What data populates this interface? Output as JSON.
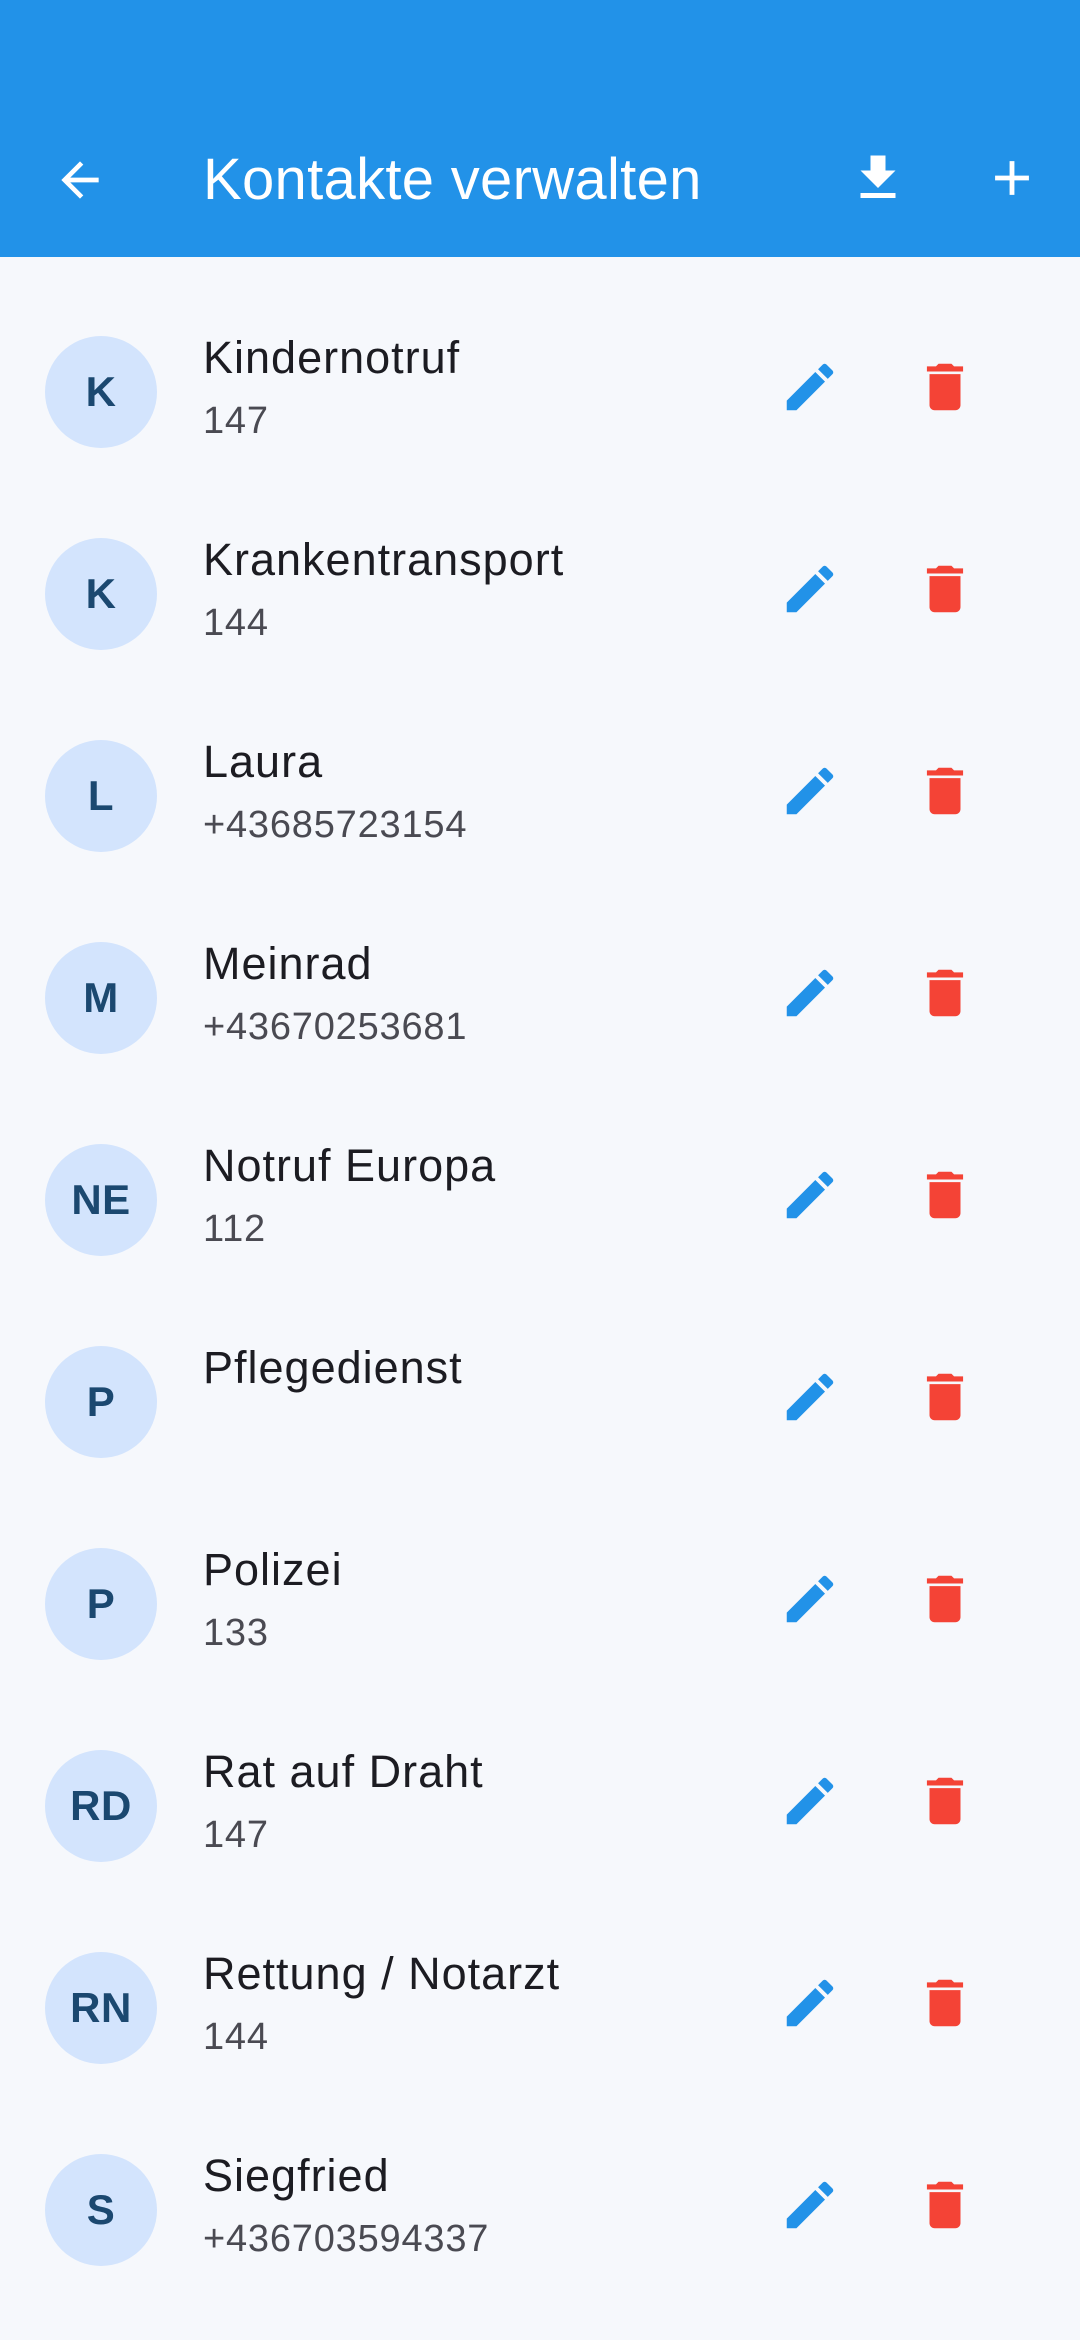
{
  "appbar": {
    "title": "Kontakte verwalten",
    "back_icon": "arrow-back-icon",
    "download_icon": "download-icon",
    "add_icon": "add-icon",
    "background_color": "#2292E8"
  },
  "colors": {
    "edit_icon": "#2292E8",
    "delete_icon": "#F44336",
    "avatar_bg": "#D3E4FD",
    "avatar_text": "#1B4870",
    "page_bg": "#F6F8FC"
  },
  "contacts": [
    {
      "initials": "K",
      "name": "Kindernotruf",
      "phone": "147"
    },
    {
      "initials": "K",
      "name": "Krankentransport",
      "phone": "144"
    },
    {
      "initials": "L",
      "name": "Laura",
      "phone": "+43685723154"
    },
    {
      "initials": "M",
      "name": "Meinrad",
      "phone": "+43670253681"
    },
    {
      "initials": "NE",
      "name": "Notruf Europa",
      "phone": "112"
    },
    {
      "initials": "P",
      "name": "Pflegedienst",
      "phone": ""
    },
    {
      "initials": "P",
      "name": "Polizei",
      "phone": "133"
    },
    {
      "initials": "RD",
      "name": "Rat auf Draht",
      "phone": "147"
    },
    {
      "initials": "RN",
      "name": "Rettung / Notarzt",
      "phone": "144"
    },
    {
      "initials": "S",
      "name": "Siegfried",
      "phone": "+436703594337"
    }
  ]
}
